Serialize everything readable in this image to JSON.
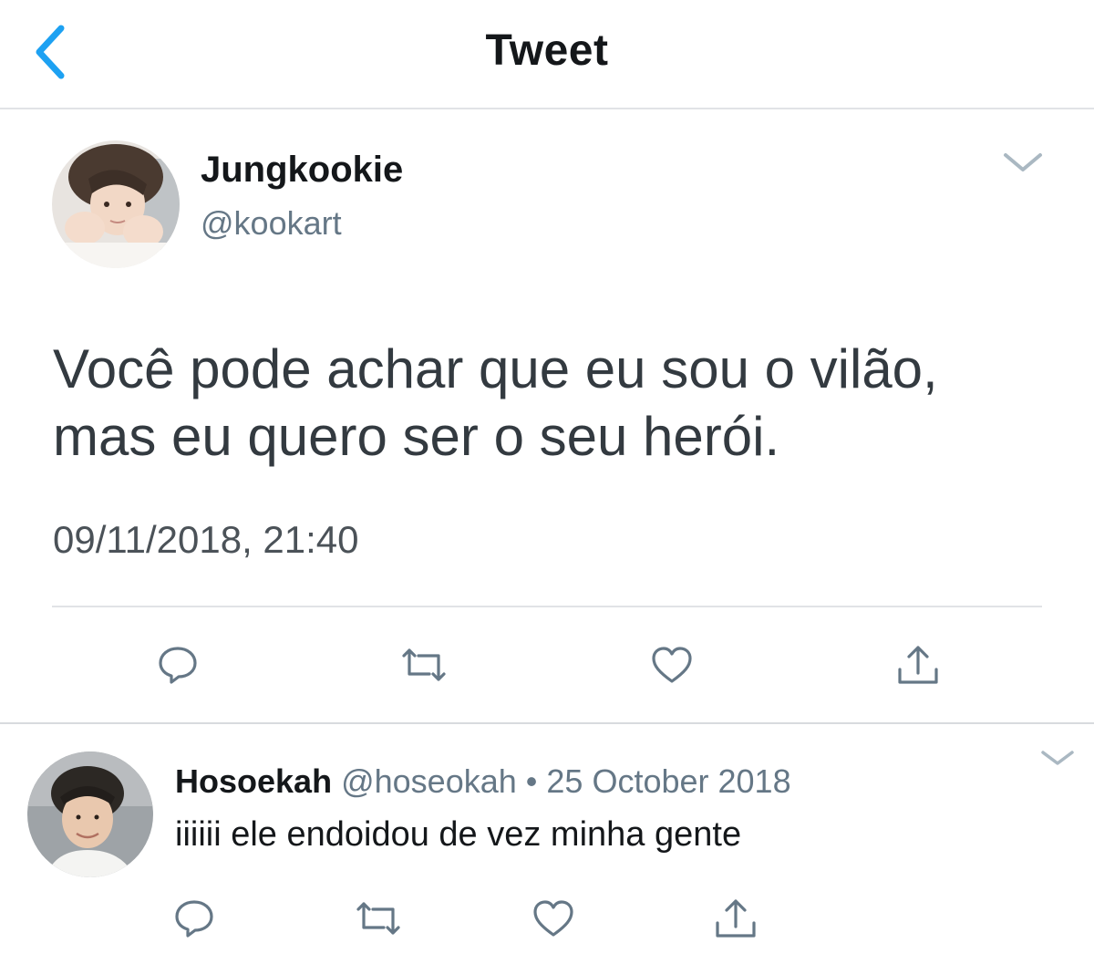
{
  "nav": {
    "title": "Tweet",
    "back_icon": "chevron-left-icon"
  },
  "colors": {
    "accent": "#1da1f2",
    "text": "#14171a",
    "secondary": "#657786",
    "divider": "#e1e3e6"
  },
  "tweet": {
    "author_name": "Jungkookie",
    "author_handle": "@kookart",
    "text": "Você pode achar que eu sou o vilão, mas eu quero ser o seu herói.",
    "timestamp": "09/11/2018, 21:40",
    "actions": [
      "reply-icon",
      "retweet-icon",
      "like-icon",
      "share-icon"
    ]
  },
  "reply": {
    "author_name": "Hosoekah",
    "author_handle": "@hoseokah",
    "separator": "•",
    "date": "25 October 2018",
    "text": "iiiiii ele endoidou de vez minha gente",
    "actions": [
      "reply-icon",
      "retweet-icon",
      "like-icon",
      "share-icon"
    ]
  }
}
